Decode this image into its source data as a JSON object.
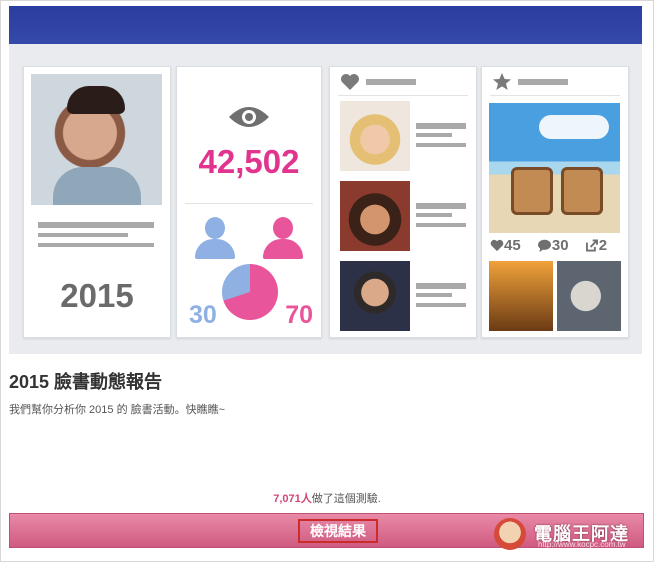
{
  "banner": {
    "card_year": "2015",
    "views_count": "42,502",
    "gender": {
      "male_percent": "30",
      "female_percent": "70"
    },
    "post_stats": {
      "likes": "45",
      "comments": "30",
      "shares": "2"
    }
  },
  "app": {
    "title": "2015 臉書動態報告",
    "description": "我們幫你分析你 2015 的 臉書活動。快瞧瞧~",
    "participants_count": "7,071人",
    "participants_suffix": "做了這個測驗.",
    "view_results_label": "檢視結果"
  },
  "watermark": {
    "text": "電腦王阿達",
    "url": "http://www.kocpc.com.tw"
  },
  "colors": {
    "banner_top": "#3449a9",
    "accent_pink": "#e1348e",
    "male_blue": "#8fb0e3",
    "cta_pink": "#d96b90"
  },
  "icons": [
    "eye-icon",
    "heart-icon",
    "star-icon",
    "male-icon",
    "female-icon",
    "comment-icon",
    "share-icon"
  ]
}
